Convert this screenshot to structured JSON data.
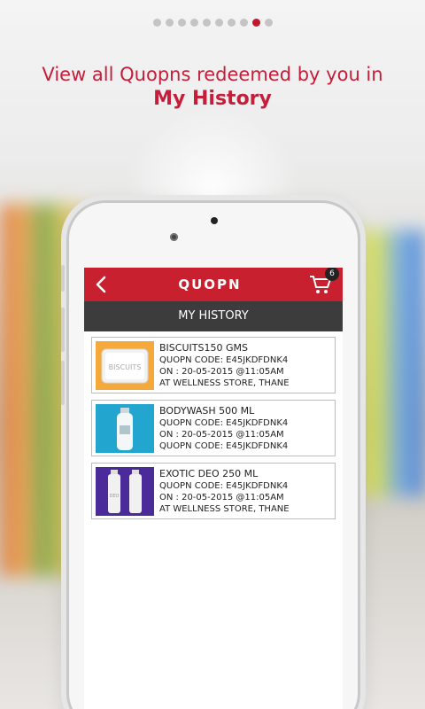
{
  "pager": {
    "count": 10,
    "active_index": 8
  },
  "headline": {
    "line1": "View all Quopns redeemed by you in",
    "line2": "My History"
  },
  "app": {
    "brand": "QUOPN",
    "cart_badge": "6",
    "section_title": "MY HISTORY"
  },
  "items": [
    {
      "title": "BISCUITS150 GMS",
      "line2": "QUOPN CODE: E45JKDFDNK4",
      "line3": "ON : 20-05-2015 @11:05AM",
      "line4": "AT WELLNESS STORE, THANE",
      "thumb_label": "BISCUITS"
    },
    {
      "title": "BODYWASH 500 ML",
      "line2": "QUOPN CODE: E45JKDFDNK4",
      "line3": "ON : 20-05-2015 @11:05AM",
      "line4": "QUOPN CODE: E45JKDFDNK4"
    },
    {
      "title": "EXOTIC DEO 250 ML",
      "line2": "QUOPN CODE: E45JKDFDNK4",
      "line3": "ON : 20-05-2015 @11:05AM",
      "line4": "AT WELLNESS STORE, THANE",
      "thumb_label": "DEO"
    }
  ],
  "colors": {
    "accent": "#c8202f",
    "headline": "#c41e3a",
    "subbar": "#3c3c3c"
  },
  "icons": {
    "back": "chevron-left-icon",
    "cart": "cart-icon"
  }
}
